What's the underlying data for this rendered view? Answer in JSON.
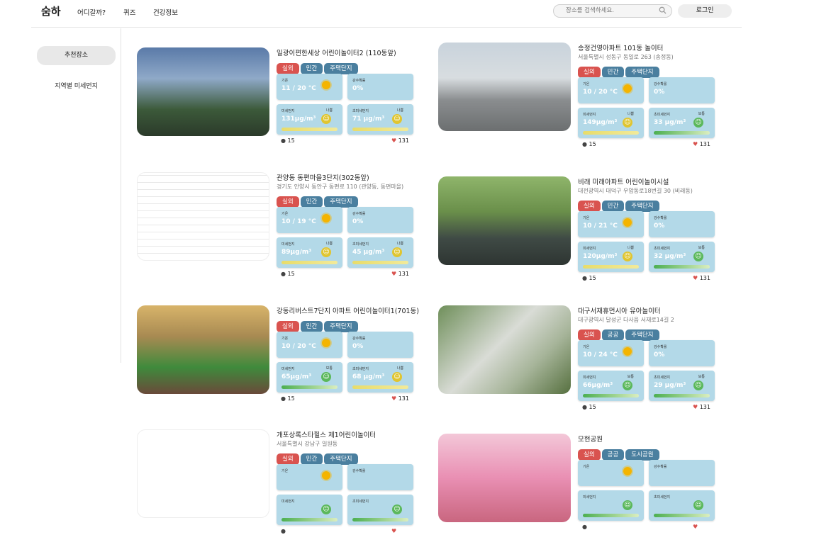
{
  "header": {
    "logo": "숨하",
    "nav": [
      "어디갈까?",
      "퀴즈",
      "건강정보"
    ],
    "search_placeholder": "장소를 검색하세요.",
    "login": "로그인"
  },
  "sidebar": {
    "items": [
      "추천장소",
      "지역별 미세먼지"
    ]
  },
  "labels": {
    "temp": "기온",
    "rain": "강수확률",
    "pm10": "미세먼지",
    "pm25": "초미세먼지",
    "grade_bad": "나쁨",
    "grade_good": "보통"
  },
  "cards": [
    {
      "title": "일광이편한세상 어린이놀이터2 (110동앞)",
      "address": "",
      "tags": [
        "실외",
        "민간",
        "주택단지"
      ],
      "temp": "11 / 20 °C",
      "rain": "0%",
      "pm10": "131μg/m³",
      "pm25": "71 μg/m³",
      "pm10_grade": "나쁨",
      "pm25_grade": "나쁨",
      "comments": "15",
      "likes": "131"
    },
    {
      "title": "송정건영아파트 101동 놀이터",
      "address": "서울특별시 성동구 동일로 263 (송정동)",
      "tags": [
        "실외",
        "민간",
        "주택단지"
      ],
      "temp": "10 / 20 °C",
      "rain": "0%",
      "pm10": "149μg/m³",
      "pm25": "33 μg/m³",
      "pm10_grade": "나쁨",
      "pm25_grade": "보통",
      "comments": "15",
      "likes": "131"
    },
    {
      "title": "관양동 동편마을3단지(302동앞)",
      "address": "경기도 안양시 동안구 동편로 110 (관양동, 동편마을)",
      "tags": [
        "실외",
        "민간",
        "주택단지"
      ],
      "temp": "10 / 19 °C",
      "rain": "0%",
      "pm10": "89μg/m³",
      "pm25": "45 μg/m³",
      "pm10_grade": "나쁨",
      "pm25_grade": "나쁨",
      "comments": "15",
      "likes": "131"
    },
    {
      "title": "비래 미래아파트 어린이놀이시설",
      "address": "대전광역시 대덕구 우암동로18번길 30 (비래동)",
      "tags": [
        "실외",
        "민간",
        "주택단지"
      ],
      "temp": "10 / 21 °C",
      "rain": "0%",
      "pm10": "120μg/m³",
      "pm25": "32 μg/m³",
      "pm10_grade": "나쁨",
      "pm25_grade": "보통",
      "comments": "15",
      "likes": "131"
    },
    {
      "title": "강동리버스트7단지 아파트 어린이놀이터1(701동)",
      "address": "",
      "tags": [
        "실외",
        "민간",
        "주택단지"
      ],
      "temp": "10 / 20 °C",
      "rain": "0%",
      "pm10": "65μg/m³",
      "pm25": "68 μg/m³",
      "pm10_grade": "보통",
      "pm25_grade": "나쁨",
      "comments": "15",
      "likes": "131"
    },
    {
      "title": "대구서재휴먼시아 유아놀이터",
      "address": "대구광역시 달성군 다사읍 서재로14길 2",
      "tags": [
        "실외",
        "공공",
        "주택단지"
      ],
      "temp": "10 / 24 °C",
      "rain": "0%",
      "pm10": "66μg/m³",
      "pm25": "29 μg/m³",
      "pm10_grade": "보통",
      "pm25_grade": "보통",
      "comments": "15",
      "likes": "131"
    },
    {
      "title": "개포상록스타힐스 제1어린이놀이터",
      "address": "서울특별시 강남구 일원동",
      "tags": [
        "실외",
        "민간",
        "주택단지"
      ],
      "temp": "",
      "rain": "",
      "pm10": "",
      "pm25": "",
      "pm10_grade": "",
      "pm25_grade": "",
      "comments": "",
      "likes": ""
    },
    {
      "title": "모현공원",
      "address": "",
      "tags": [
        "실외",
        "공공",
        "도시공원"
      ],
      "temp": "",
      "rain": "",
      "pm10": "",
      "pm25": "",
      "pm10_grade": "",
      "pm25_grade": "",
      "comments": "",
      "likes": ""
    }
  ],
  "colors": {
    "tag_red": "#d9534f",
    "tag_blue": "#4a7f9f",
    "box_bg": "#b3d9e8"
  }
}
